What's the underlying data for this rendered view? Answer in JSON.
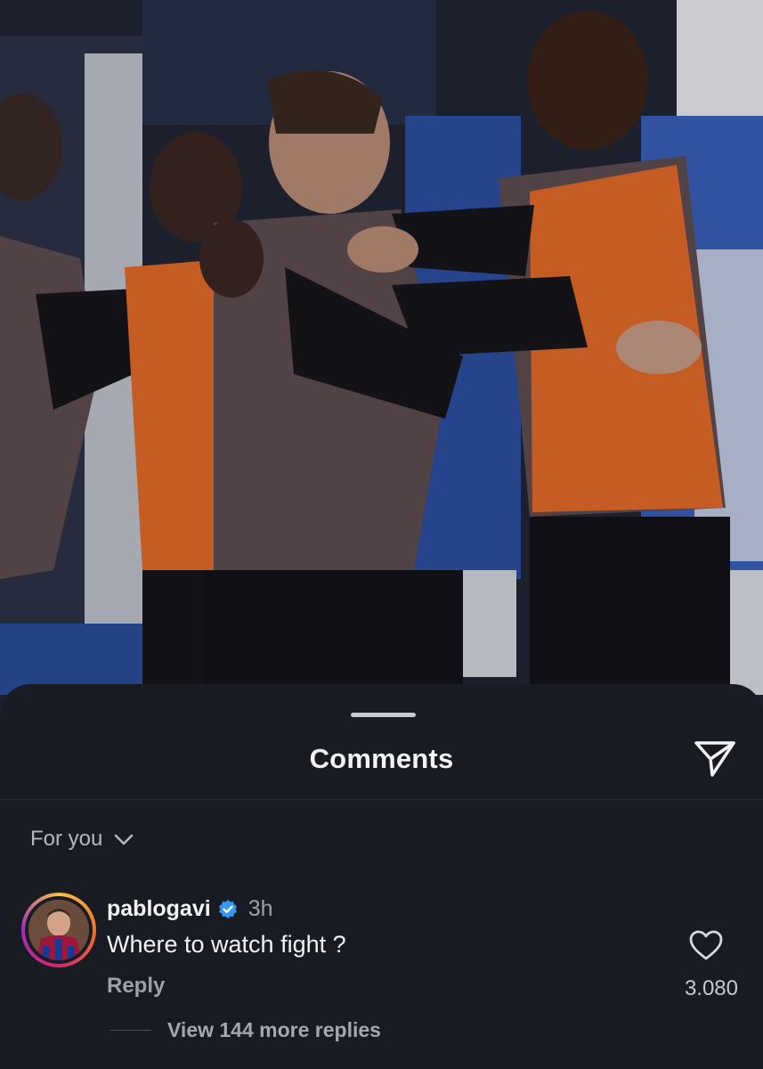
{
  "photo": {
    "description_icon": "photo-locker-room",
    "colors": {
      "bib": "#e0692a",
      "kit": "#5d4c4f",
      "sleeve": "#15151b",
      "locker": "#2b4ea0"
    }
  },
  "sheet": {
    "title": "Comments",
    "share_icon": "send-icon",
    "filter_label": "For you",
    "filter_icon": "chevron-down-icon"
  },
  "comment": {
    "username": "pablogavi",
    "verified_icon": "verified-badge-icon",
    "time": "3h",
    "text": "Where to watch fight ?",
    "reply_label": "Reply",
    "like_icon": "heart-icon",
    "like_count": "3.080",
    "view_replies": "View 144 more replies"
  },
  "colors": {
    "sheet_bg": "#191b22",
    "verified": "#3897f0",
    "muted": "#9ea1a9"
  }
}
